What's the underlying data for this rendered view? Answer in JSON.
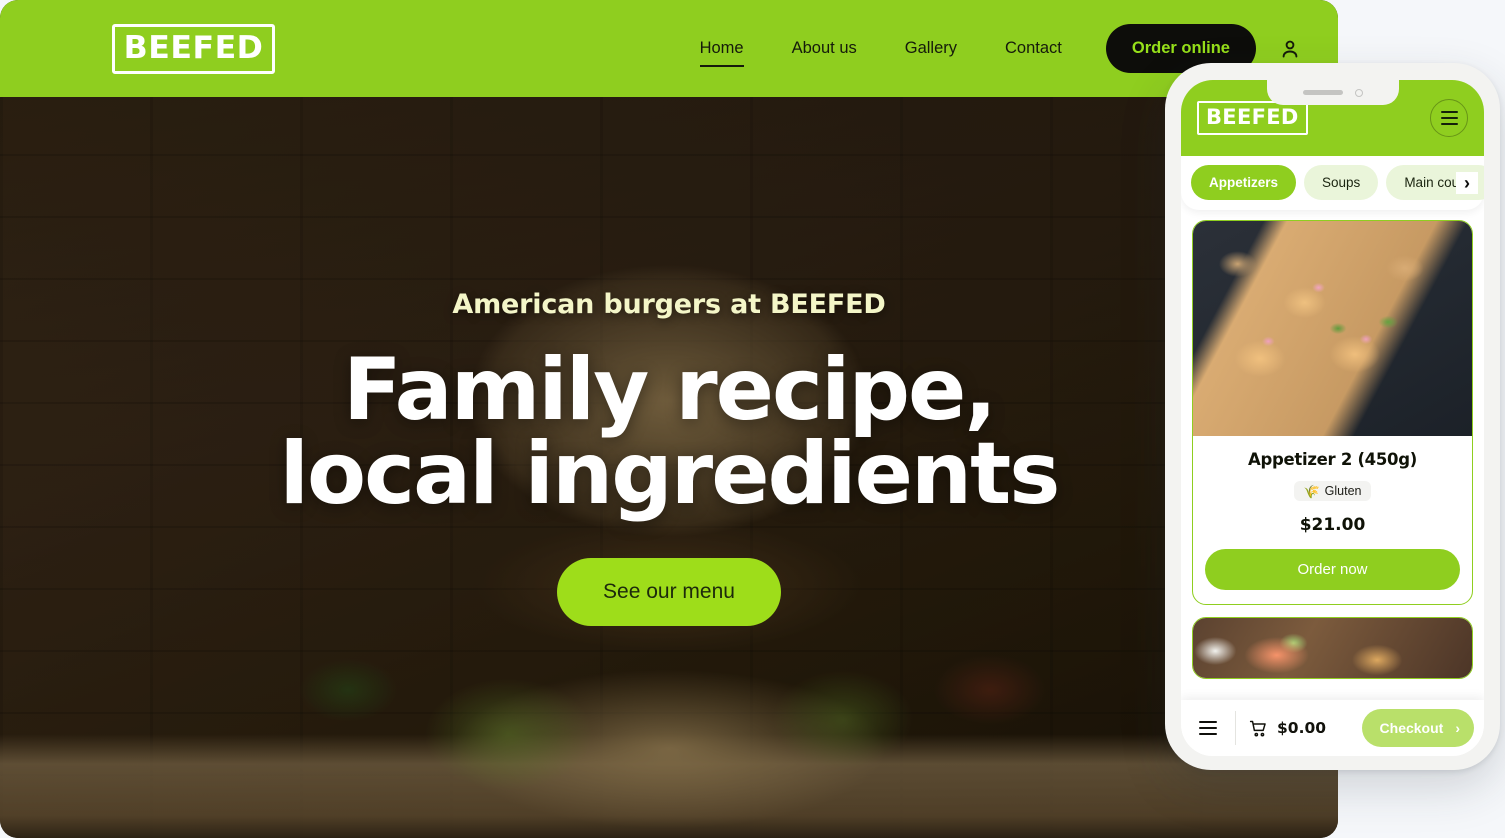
{
  "brand": {
    "name": "BEEFED",
    "accent_green": "#8fce1f",
    "bright_green": "#9edd1a",
    "dark": "#0d0d0a"
  },
  "site": {
    "nav": {
      "links": [
        {
          "label": "Home",
          "active": true
        },
        {
          "label": "About us",
          "active": false
        },
        {
          "label": "Gallery",
          "active": false
        },
        {
          "label": "Contact",
          "active": false
        }
      ],
      "order_button": "Order online",
      "account_icon": "user-icon"
    },
    "hero": {
      "eyebrow": "American burgers at BEEFED",
      "title": "Family recipe, local ingredients",
      "cta": "See our menu"
    }
  },
  "phone": {
    "header": {
      "logo": "BEEFED",
      "menu_icon": "hamburger-icon"
    },
    "tabs": [
      {
        "label": "Appetizers",
        "active": true
      },
      {
        "label": "Soups",
        "active": false
      },
      {
        "label": "Main course",
        "active": false
      }
    ],
    "tab_next_icon": "chevron-right-icon",
    "products": [
      {
        "name": "Appetizer 2 (450g)",
        "allergen": "Gluten",
        "allergen_icon": "wheat-icon",
        "price": "$21.00",
        "order_label": "Order now"
      }
    ],
    "bottom_bar": {
      "menu_icon": "hamburger-icon",
      "cart_icon": "cart-icon",
      "cart_total": "$0.00",
      "checkout_label": "Checkout",
      "checkout_icon": "chevron-right-icon"
    }
  }
}
